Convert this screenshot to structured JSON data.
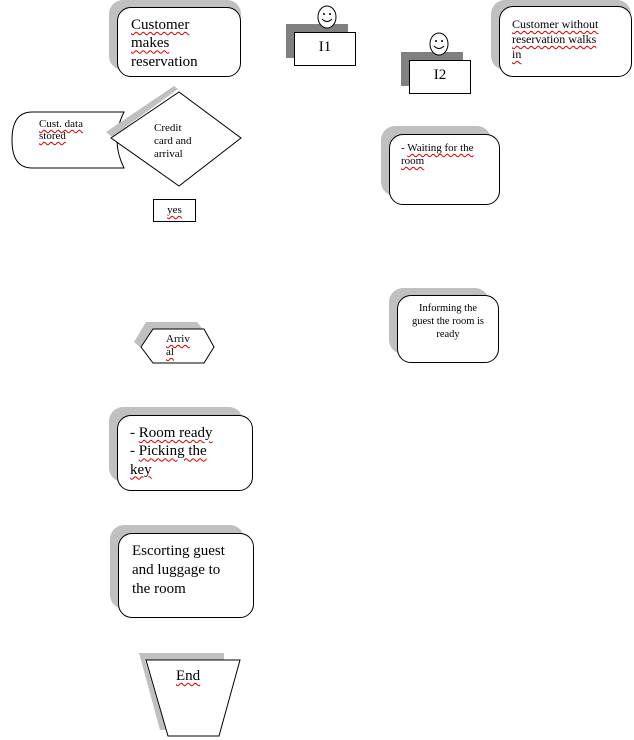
{
  "diagram": {
    "nodes": {
      "customer_reservation": {
        "lines": [
          "Customer",
          "makes",
          "reservation"
        ]
      },
      "i1": {
        "label": "I1",
        "icon": "smiley-face-icon"
      },
      "i2": {
        "label": "I2",
        "icon": "smiley-face-icon"
      },
      "customer_walk_in": {
        "lines": [
          "Customer without",
          "reservation walks",
          "in"
        ]
      },
      "cust_data_stored": {
        "lines": [
          "Cust. data",
          "stored"
        ]
      },
      "credit_card_arrival": {
        "lines": [
          "Credit",
          "card and",
          "arrival"
        ]
      },
      "yes_label": {
        "label": "yes"
      },
      "waiting_room": {
        "lines": [
          "- Waiting for the",
          "room"
        ]
      },
      "informing_guest": {
        "lines": [
          "Informing the",
          "guest the room is",
          "ready"
        ]
      },
      "arrival": {
        "lines": [
          "Arriv",
          "al"
        ]
      },
      "room_ready": {
        "lines": [
          "- Room ready",
          "- Picking the",
          "key"
        ]
      },
      "escorting": {
        "lines": [
          "Escorting guest",
          "and luggage to",
          "the room"
        ]
      },
      "end": {
        "label": "End"
      }
    },
    "colors": {
      "shadow": "#c0c0c0",
      "dark_shadow": "#808080",
      "spell_underline": "#d00000",
      "grammar_underline": "#2040c0"
    }
  }
}
